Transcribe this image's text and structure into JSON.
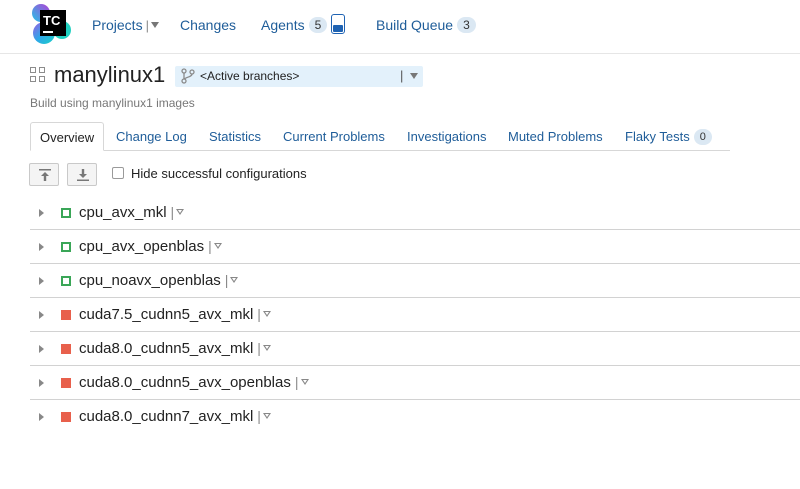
{
  "logo": {
    "text": "TC"
  },
  "nav": {
    "projects_label": "Projects",
    "changes_label": "Changes",
    "agents_label": "Agents",
    "agents_count": "5",
    "queue_label": "Build Queue",
    "queue_count": "3"
  },
  "page": {
    "title": "manylinux1",
    "branch_selector": "<Active branches>",
    "subtitle": "Build using manylinux1 images"
  },
  "tabs": [
    {
      "label": "Overview"
    },
    {
      "label": "Change Log"
    },
    {
      "label": "Statistics"
    },
    {
      "label": "Current Problems"
    },
    {
      "label": "Investigations"
    },
    {
      "label": "Muted Problems"
    },
    {
      "label": "Flaky Tests",
      "badge": "0"
    }
  ],
  "toolbar": {
    "hide_successful_label": "Hide successful configurations",
    "hide_successful_checked": false
  },
  "configurations": [
    {
      "name": "cpu_avx_mkl",
      "status": "success"
    },
    {
      "name": "cpu_avx_openblas",
      "status": "success"
    },
    {
      "name": "cpu_noavx_openblas",
      "status": "success"
    },
    {
      "name": "cuda7.5_cudnn5_avx_mkl",
      "status": "failure"
    },
    {
      "name": "cuda8.0_cudnn5_avx_mkl",
      "status": "failure"
    },
    {
      "name": "cuda8.0_cudnn5_avx_openblas",
      "status": "failure"
    },
    {
      "name": "cuda8.0_cudnn7_avx_mkl",
      "status": "failure"
    }
  ],
  "colors": {
    "link": "#1f5d99",
    "success": "#3aa657",
    "failure": "#e8604c",
    "branch_bg": "#e3f1fb",
    "badge_bg": "#dbe8f3"
  }
}
